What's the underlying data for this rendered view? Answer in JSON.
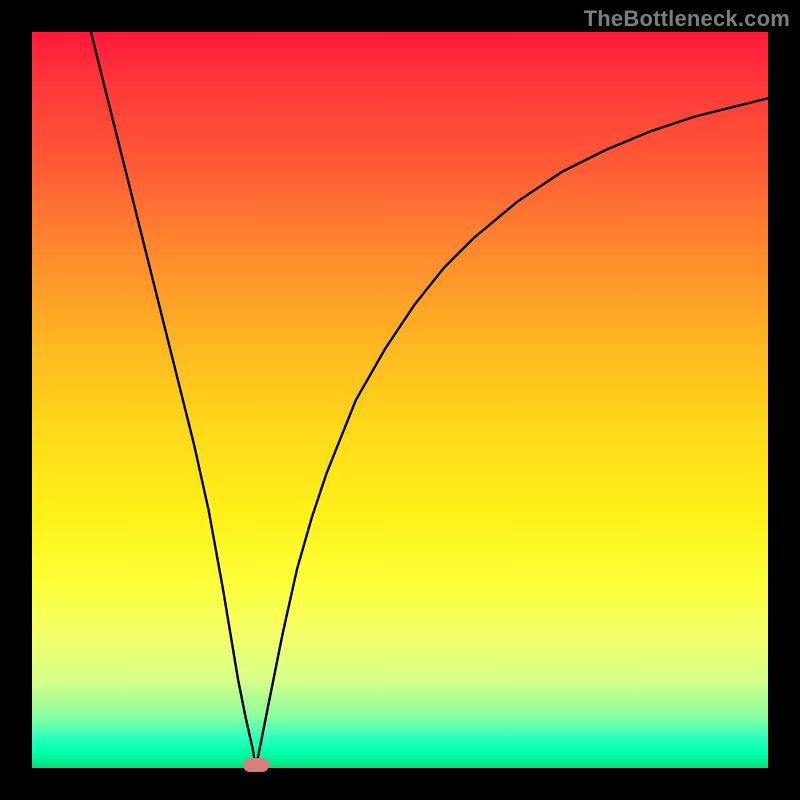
{
  "watermark": "TheBottleneck.com",
  "chart_data": {
    "type": "line",
    "title": "",
    "xlabel": "",
    "ylabel": "",
    "xlim": [
      0,
      100
    ],
    "ylim": [
      0,
      100
    ],
    "grid": false,
    "legend": false,
    "notch_x_percent": 30.4,
    "marker": {
      "x_percent": 30.4,
      "y_percent": 0
    },
    "series": [
      {
        "name": "bottleneck-curve",
        "x": [
          8,
          10,
          12,
          14,
          16,
          18,
          20,
          22,
          24,
          26,
          27,
          28,
          29,
          30,
          30.4,
          31,
          32,
          33,
          34,
          36,
          38,
          40,
          44,
          48,
          52,
          56,
          60,
          66,
          72,
          78,
          84,
          90,
          96,
          100
        ],
        "y": [
          100,
          92,
          84,
          76,
          68,
          60,
          52,
          44,
          35,
          24,
          18,
          12,
          7,
          2.5,
          0,
          3,
          8,
          13,
          18,
          27,
          34,
          40,
          50,
          57,
          63,
          68,
          72,
          77,
          81,
          84,
          86.5,
          88.5,
          90,
          91
        ]
      }
    ],
    "gradient_stops": [
      {
        "pct": 0,
        "color": "#ff1a3a"
      },
      {
        "pct": 8,
        "color": "#ff3a3a"
      },
      {
        "pct": 18,
        "color": "#ff5a36"
      },
      {
        "pct": 30,
        "color": "#ff8a2e"
      },
      {
        "pct": 42,
        "color": "#ffb522"
      },
      {
        "pct": 54,
        "color": "#ffd91a"
      },
      {
        "pct": 66,
        "color": "#fff21a"
      },
      {
        "pct": 75,
        "color": "#fdff3a"
      },
      {
        "pct": 82,
        "color": "#f4ff6a"
      },
      {
        "pct": 88,
        "color": "#d8ff8a"
      },
      {
        "pct": 93,
        "color": "#8affa0"
      },
      {
        "pct": 96,
        "color": "#2affc0"
      },
      {
        "pct": 98,
        "color": "#00ffa8"
      },
      {
        "pct": 100,
        "color": "#00e078"
      }
    ]
  }
}
